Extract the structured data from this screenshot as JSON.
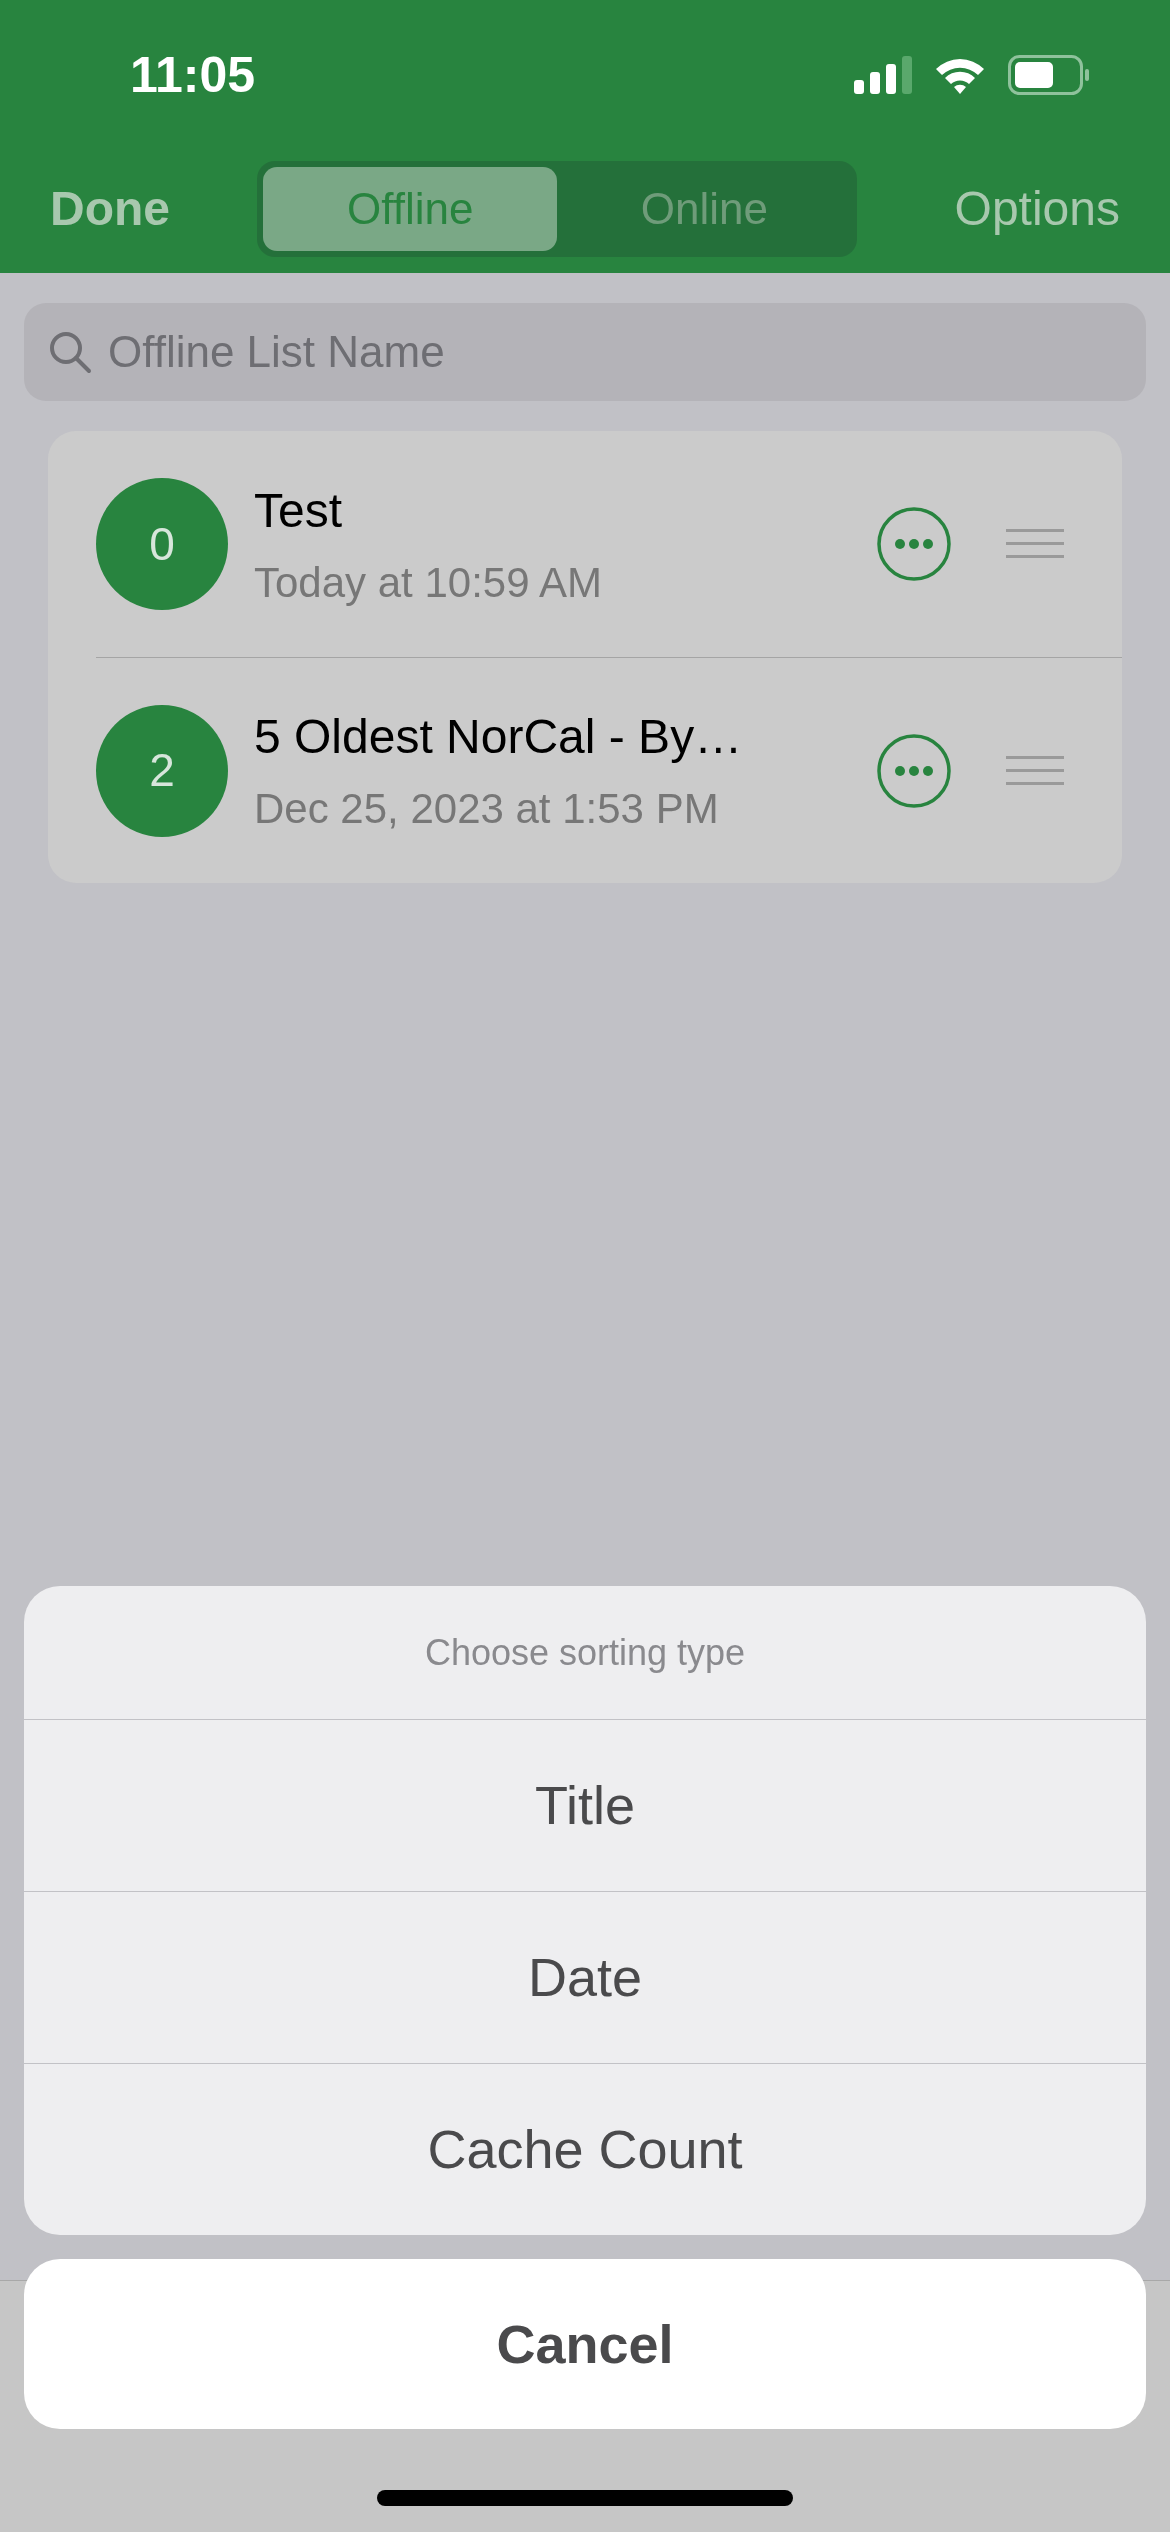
{
  "status_bar": {
    "time": "11:05"
  },
  "nav_bar": {
    "left_button": "Done",
    "segments": [
      {
        "label": "Offline",
        "selected": true
      },
      {
        "label": "Online",
        "selected": false
      }
    ],
    "right_button": "Options"
  },
  "search": {
    "placeholder": "Offline List Name"
  },
  "lists": [
    {
      "count": "0",
      "title": "Test",
      "date": "Today at 10:59 AM"
    },
    {
      "count": "2",
      "title": "5 Oldest NorCal - By…",
      "date": "Dec 25, 2023 at 1:53 PM"
    }
  ],
  "action_sheet": {
    "title": "Choose sorting type",
    "options": [
      "Title",
      "Date",
      "Cache Count"
    ],
    "cancel": "Cancel"
  }
}
